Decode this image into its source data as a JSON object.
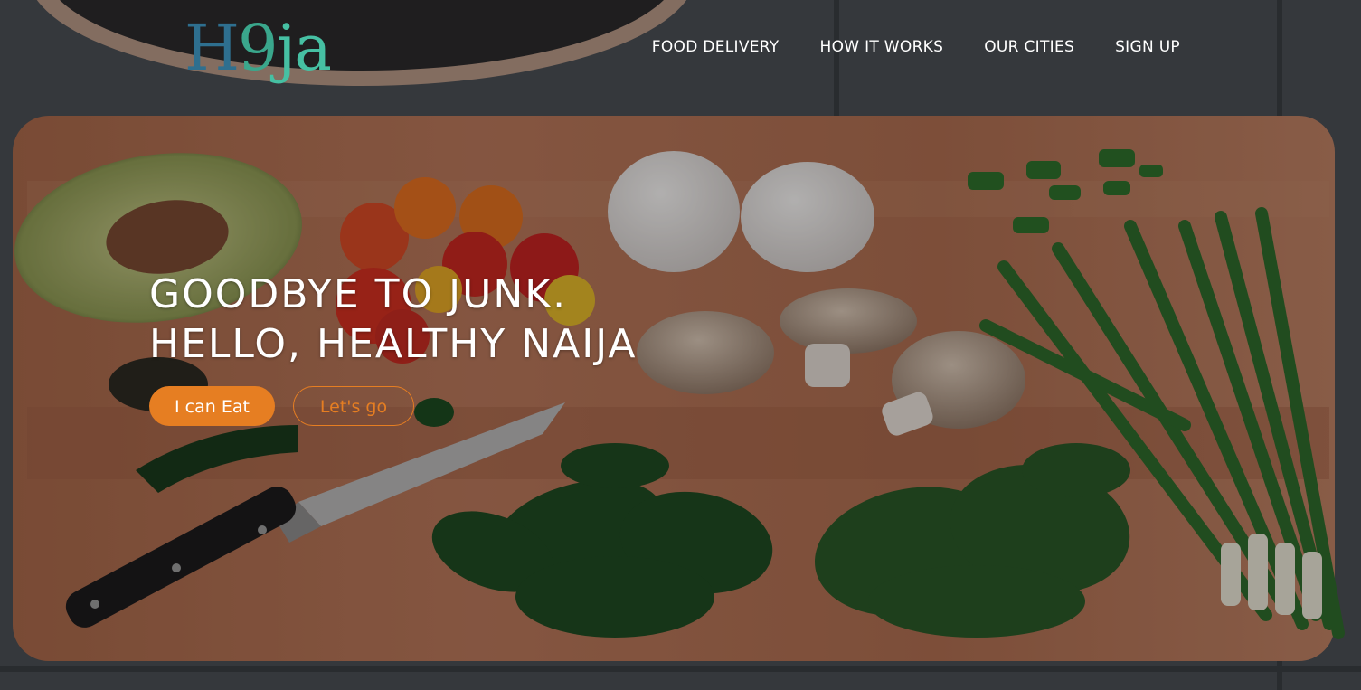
{
  "logo": {
    "part1": "H",
    "part2": "9",
    "part3": "ja"
  },
  "nav": {
    "items": [
      {
        "label": "FOOD DELIVERY"
      },
      {
        "label": "HOW IT WORKS"
      },
      {
        "label": "OUR CITIES"
      },
      {
        "label": "SIGN UP"
      }
    ]
  },
  "hero": {
    "line1": "GOODBYE TO JUNK.",
    "line2": "HELLO, HEALTHY NAIJA",
    "primary_button": "I can Eat",
    "secondary_button": "Let's go"
  },
  "colors": {
    "accent": "#e67e22",
    "logo_blue": "#2e6f8f",
    "logo_green": "#46c0a3",
    "text": "#ffffff"
  },
  "icons": {
    "hero_image": "food-cutting-board-photo"
  }
}
